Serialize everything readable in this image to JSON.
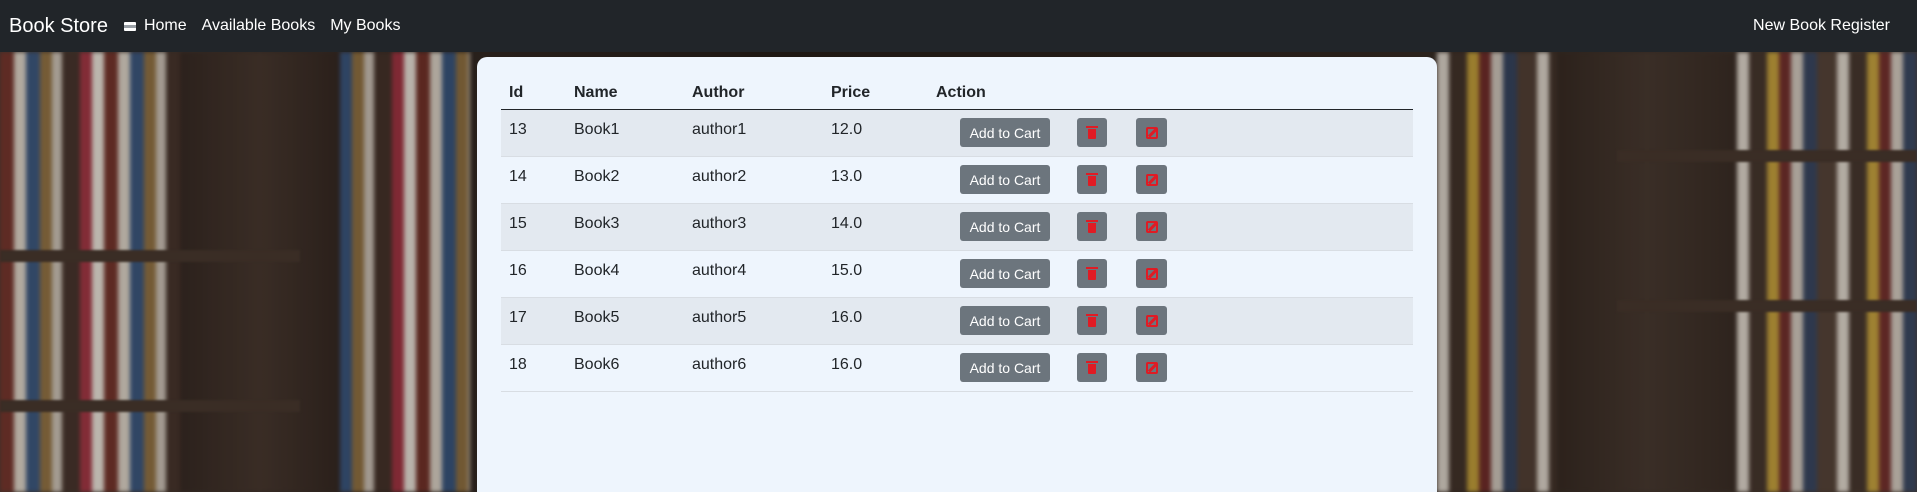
{
  "navbar": {
    "brand": "Book Store",
    "links": [
      "Home",
      "Available Books",
      "My Books"
    ],
    "right_link": "New Book Register"
  },
  "table": {
    "headers": [
      "Id",
      "Name",
      "Author",
      "Price",
      "Action"
    ],
    "rows": [
      {
        "id": "13",
        "name": "Book1",
        "author": "author1",
        "price": "12.0"
      },
      {
        "id": "14",
        "name": "Book2",
        "author": "author2",
        "price": "13.0"
      },
      {
        "id": "15",
        "name": "Book3",
        "author": "author3",
        "price": "14.0"
      },
      {
        "id": "16",
        "name": "Book4",
        "author": "author4",
        "price": "15.0"
      },
      {
        "id": "17",
        "name": "Book5",
        "author": "author5",
        "price": "16.0"
      },
      {
        "id": "18",
        "name": "Book6",
        "author": "author6",
        "price": "16.0"
      }
    ],
    "add_to_cart_label": "Add to Cart",
    "delete_icon": "trash-icon",
    "edit_icon": "edit-icon"
  },
  "colors": {
    "navbar_bg": "#212529",
    "card_bg": "#eef5fd",
    "button_bg": "#6c757d",
    "icon_red": "#e01b24"
  }
}
